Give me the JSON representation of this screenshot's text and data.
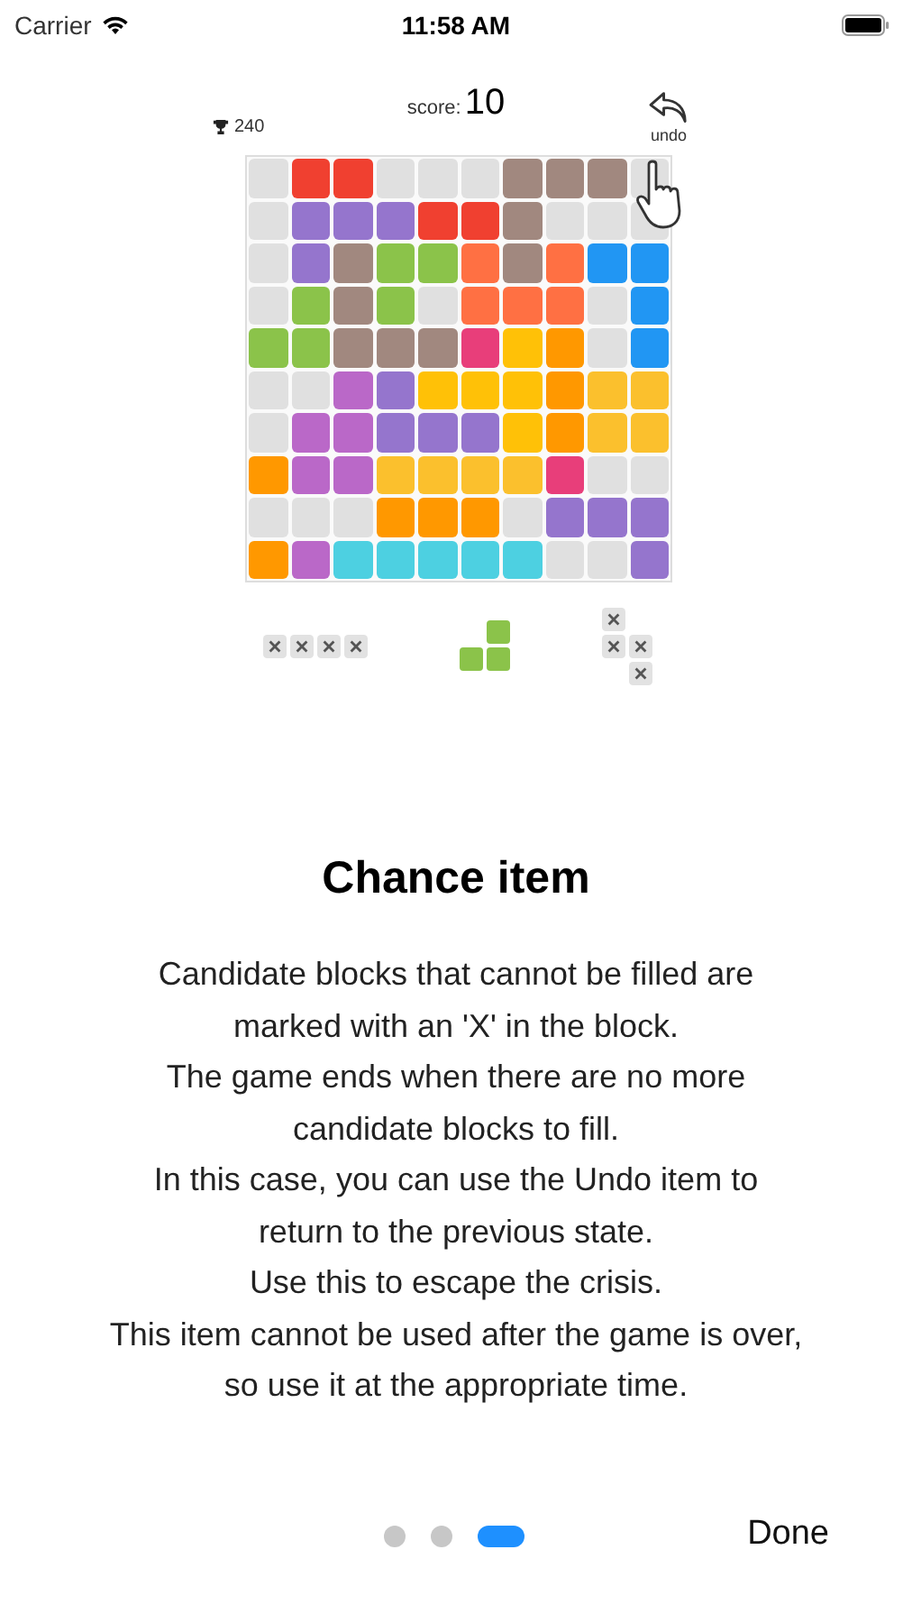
{
  "status_bar": {
    "carrier": "Carrier",
    "time": "11:58 AM"
  },
  "game": {
    "best": "240",
    "score_label": "score:",
    "score": "10",
    "undo": "undo",
    "grid": [
      [
        {
          "color": "#e0e0e0"
        },
        {
          "color": "#f04030"
        },
        {
          "color": "#f04030"
        },
        {
          "color": "#e0e0e0"
        },
        {
          "color": "#e0e0e0"
        },
        {
          "color": "#e0e0e0"
        },
        {
          "color": "#a1887f"
        },
        {
          "color": "#a1887f"
        },
        {
          "color": "#a1887f"
        },
        {
          "color": "#e0e0e0"
        }
      ],
      [
        {
          "color": "#e0e0e0"
        },
        {
          "color": "#9575cd"
        },
        {
          "color": "#9575cd"
        },
        {
          "color": "#9575cd"
        },
        {
          "color": "#f04030"
        },
        {
          "color": "#f04030"
        },
        {
          "color": "#a1887f"
        },
        {
          "color": "#e0e0e0"
        },
        {
          "color": "#e0e0e0"
        },
        {
          "color": "#e0e0e0"
        }
      ],
      [
        {
          "color": "#e0e0e0"
        },
        {
          "color": "#9575cd"
        },
        {
          "color": "#a1887f"
        },
        {
          "color": "#8bc34a"
        },
        {
          "color": "#8bc34a"
        },
        {
          "color": "#ff7043"
        },
        {
          "color": "#a1887f"
        },
        {
          "color": "#ff7043"
        },
        {
          "color": "#2196f3"
        },
        {
          "color": "#2196f3"
        }
      ],
      [
        {
          "color": "#e0e0e0"
        },
        {
          "color": "#8bc34a"
        },
        {
          "color": "#a1887f"
        },
        {
          "color": "#8bc34a"
        },
        {
          "color": "#e0e0e0"
        },
        {
          "color": "#ff7043"
        },
        {
          "color": "#ff7043"
        },
        {
          "color": "#ff7043"
        },
        {
          "color": "#e0e0e0"
        },
        {
          "color": "#2196f3"
        }
      ],
      [
        {
          "color": "#8bc34a"
        },
        {
          "color": "#8bc34a"
        },
        {
          "color": "#a1887f"
        },
        {
          "color": "#a1887f"
        },
        {
          "color": "#a1887f"
        },
        {
          "color": "#e83e7a"
        },
        {
          "color": "#ffc107"
        },
        {
          "color": "#ff9800"
        },
        {
          "color": "#e0e0e0"
        },
        {
          "color": "#2196f3"
        }
      ],
      [
        {
          "color": "#e0e0e0"
        },
        {
          "color": "#e0e0e0"
        },
        {
          "color": "#ba68c8"
        },
        {
          "color": "#9575cd"
        },
        {
          "color": "#ffc107"
        },
        {
          "color": "#ffc107"
        },
        {
          "color": "#ffc107"
        },
        {
          "color": "#ff9800"
        },
        {
          "color": "#fbc02d"
        },
        {
          "color": "#fbc02d"
        }
      ],
      [
        {
          "color": "#e0e0e0"
        },
        {
          "color": "#ba68c8"
        },
        {
          "color": "#ba68c8"
        },
        {
          "color": "#9575cd"
        },
        {
          "color": "#9575cd"
        },
        {
          "color": "#9575cd"
        },
        {
          "color": "#ffc107"
        },
        {
          "color": "#ff9800"
        },
        {
          "color": "#fbc02d"
        },
        {
          "color": "#fbc02d"
        }
      ],
      [
        {
          "color": "#ff9800"
        },
        {
          "color": "#ba68c8"
        },
        {
          "color": "#ba68c8"
        },
        {
          "color": "#fbc02d"
        },
        {
          "color": "#fbc02d"
        },
        {
          "color": "#fbc02d"
        },
        {
          "color": "#fbc02d"
        },
        {
          "color": "#e83e7a"
        },
        {
          "color": "#e0e0e0"
        },
        {
          "color": "#e0e0e0"
        }
      ],
      [
        {
          "color": "#e0e0e0"
        },
        {
          "color": "#e0e0e0"
        },
        {
          "color": "#e0e0e0"
        },
        {
          "color": "#ff9800"
        },
        {
          "color": "#ff9800"
        },
        {
          "color": "#ff9800"
        },
        {
          "color": "#e0e0e0"
        },
        {
          "color": "#9575cd"
        },
        {
          "color": "#9575cd"
        },
        {
          "color": "#9575cd"
        }
      ],
      [
        {
          "color": "#ff9800"
        },
        {
          "color": "#ba68c8"
        },
        {
          "color": "#4dd0e1"
        },
        {
          "color": "#4dd0e1"
        },
        {
          "color": "#4dd0e1"
        },
        {
          "color": "#4dd0e1"
        },
        {
          "color": "#4dd0e1"
        },
        {
          "color": "#e0e0e0"
        },
        {
          "color": "#e0e0e0"
        },
        {
          "color": "#9575cd"
        }
      ]
    ],
    "pieces": [
      {
        "blocked": true,
        "rows": [
          [
            {
              "filled": true
            },
            {
              "filled": true
            },
            {
              "filled": true
            },
            {
              "filled": true
            }
          ]
        ]
      },
      {
        "blocked": false,
        "color": "#8bc34a",
        "rows": [
          [
            {
              "filled": false
            },
            {
              "filled": true
            }
          ],
          [
            {
              "filled": true
            },
            {
              "filled": true
            }
          ]
        ]
      },
      {
        "blocked": true,
        "rows": [
          [
            {
              "filled": true
            },
            {
              "filled": false
            }
          ],
          [
            {
              "filled": true
            },
            {
              "filled": true
            }
          ],
          [
            {
              "filled": false
            },
            {
              "filled": true
            }
          ]
        ]
      }
    ]
  },
  "title": "Chance item",
  "description": "Candidate blocks that cannot be filled are marked with an 'X' in the block.\nThe game ends when there are no more candidate blocks to fill.\nIn this case, you can use the Undo item to return to the previous state.\nUse this to escape the crisis.\nThis item cannot be used after the game is over, so use it at the appropriate time.",
  "pages": [
    {
      "selected": false
    },
    {
      "selected": false
    },
    {
      "selected": true
    }
  ],
  "done_button": "Done"
}
